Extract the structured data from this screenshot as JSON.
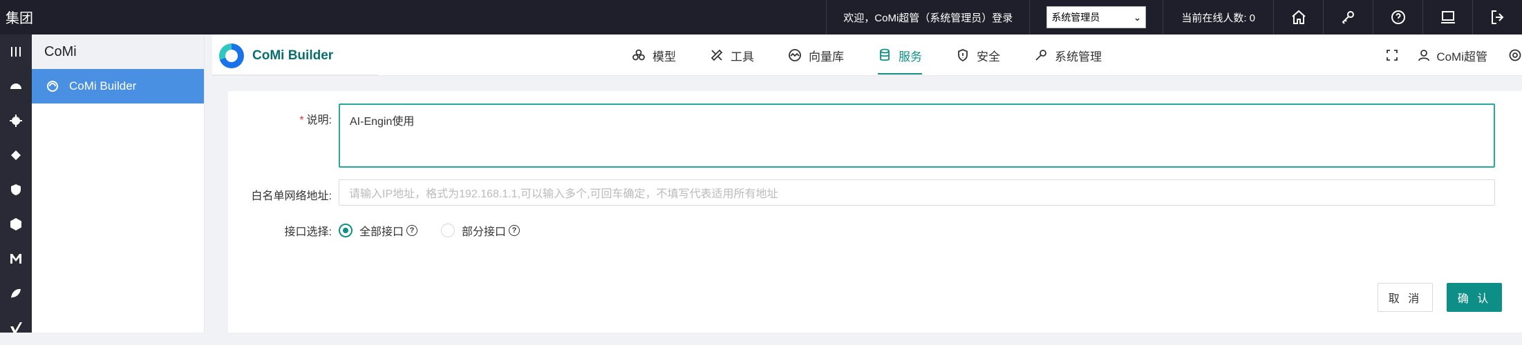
{
  "topbar": {
    "brand": "集团",
    "welcome": "欢迎，CoMi超管（系统管理员）登录",
    "role_selected": "系统管理员",
    "online_label": "当前在线人数: 0",
    "icons": [
      "home-icon",
      "key-icon",
      "help-icon",
      "monitor-icon",
      "logout-icon"
    ]
  },
  "rail": {
    "icons": [
      "menu-icon",
      "dashboard-icon",
      "settings-icon",
      "plugin-icon",
      "shield-icon",
      "hexagon-icon",
      "m-logo-icon",
      "leaf-icon",
      "v-logo-icon"
    ]
  },
  "subnav": {
    "title": "CoMi",
    "items": [
      {
        "label": "CoMi Builder",
        "icon": "builder-icon"
      }
    ]
  },
  "app": {
    "name": "CoMi Builder",
    "nav": [
      {
        "label": "模型",
        "icon": "model-icon"
      },
      {
        "label": "工具",
        "icon": "tools-icon"
      },
      {
        "label": "向量库",
        "icon": "vector-icon"
      },
      {
        "label": "服务",
        "icon": "database-icon",
        "active": true
      },
      {
        "label": "安全",
        "icon": "security-icon"
      },
      {
        "label": "系统管理",
        "icon": "wrench-icon"
      }
    ],
    "user": "CoMi超管"
  },
  "form": {
    "description_label": "说明:",
    "description_value": "AI-Engin使用",
    "whitelist_label": "白名单网络地址:",
    "whitelist_placeholder": "请输入IP地址，格式为192.168.1.1,可以输入多个,可回车确定，不填写代表适用所有地址",
    "interface_label": "接口选择:",
    "interface_options": [
      {
        "label": "全部接口",
        "checked": true
      },
      {
        "label": "部分接口",
        "checked": false
      }
    ],
    "cancel_label": "取 消",
    "confirm_label": "确 认"
  },
  "colors": {
    "accent": "#0d8f88",
    "topbar": "#1f1f2b",
    "sidebar_active": "#4a90e2"
  }
}
